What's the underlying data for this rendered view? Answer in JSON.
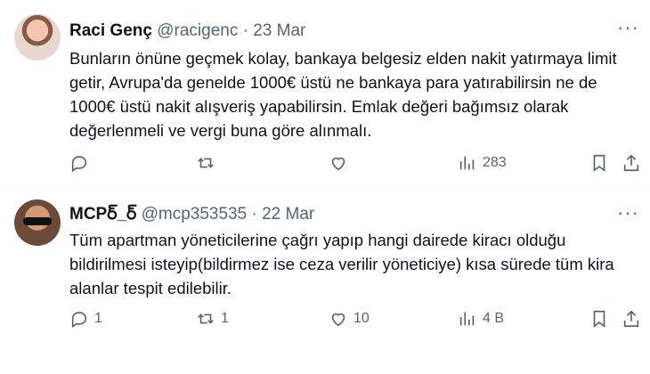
{
  "tweets": [
    {
      "name": "Raci Genç",
      "handle": "@racigenc",
      "separator": "·",
      "date": "23 Mar",
      "lines": [
        "Bunların önüne geçmek kolay, bankaya belgesiz elden nakit yatırmaya limit",
        "getir,  Avrupa'da genelde 1000€ üstü ne bankaya para yatırabilirsin ne de",
        "1000€ üstü nakit alışveriş yapabilirsin.  Emlak değeri bağımsız olarak",
        "değerlenmeli ve vergi buna göre alınmalı."
      ],
      "replies": "",
      "retweets": "",
      "likes": "",
      "views": "283"
    },
    {
      "name": "MCPర్_ర్",
      "handle": "@mcp353535",
      "separator": "·",
      "date": "22 Mar",
      "lines": [
        "Tüm apartman yöneticilerine çağrı yapıp hangi dairede kiracı olduğu",
        "bildirilmesi isteyip(bildirmez ise ceza verilir yöneticiye) kısa sürede tüm kira",
        "alanlar tespit edilebilir."
      ],
      "replies": "1",
      "retweets": "1",
      "likes": "10",
      "views": "4 B"
    }
  ],
  "more_glyph": "···",
  "icons": [
    "reply-icon",
    "retweet-icon",
    "like-icon",
    "views-icon",
    "bookmark-icon",
    "share-icon",
    "more-icon"
  ]
}
